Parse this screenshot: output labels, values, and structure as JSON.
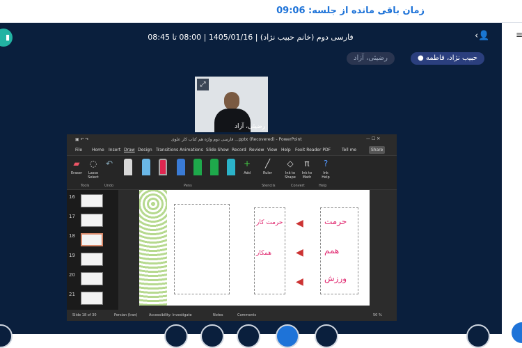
{
  "timer": "زمان باقی مانده از جلسه: 09:06",
  "session": {
    "title": "فارسی دوم (خانم حبیب نژاد) | 1405/01/16 | 08:00 تا 08:45"
  },
  "chips": [
    "حبیب نژاد، فاطمه",
    "رضیئی، آزاد"
  ],
  "video": {
    "name": "رضیئی، آزاد"
  },
  "ppt": {
    "title": "فارسی دوم واژه هم کتاب کار علوی ...pptx (Recovered) - PowerPoint",
    "menu": [
      "File",
      "Home",
      "Insert",
      "Draw",
      "Design",
      "Transitions",
      "Animations",
      "Slide Show",
      "Record",
      "Review",
      "View",
      "Help",
      "Foxit Reader PDF",
      "Tell me"
    ],
    "share": "Share",
    "ribbon": {
      "eraser": "Eraser",
      "lasso": "Lasso Select",
      "add": "Add",
      "ruler": "Ruler",
      "ink_shape": "Ink to Shape",
      "ink_math": "Ink to Math",
      "ink_help": "Ink Help",
      "tools": "Tools",
      "undo": "Undo",
      "pens": "Pens",
      "stencils": "Stencils",
      "convert": "Convert",
      "help": "Help"
    },
    "thumbs": [
      "16",
      "17",
      "18",
      "19",
      "20",
      "21"
    ],
    "status": {
      "slide": "Slide 18 of 30",
      "lang": "Persian (Iran)",
      "access": "Accessibility: Investigate",
      "notes": "Notes",
      "comments": "Comments",
      "zoom": "50 %"
    },
    "slide_words": [
      "حرمت",
      "همم",
      "ورزش",
      "حرمت کار",
      "همکار"
    ]
  },
  "colors": {
    "bg": "#0a1f3d",
    "accent": "#1e73d8"
  }
}
